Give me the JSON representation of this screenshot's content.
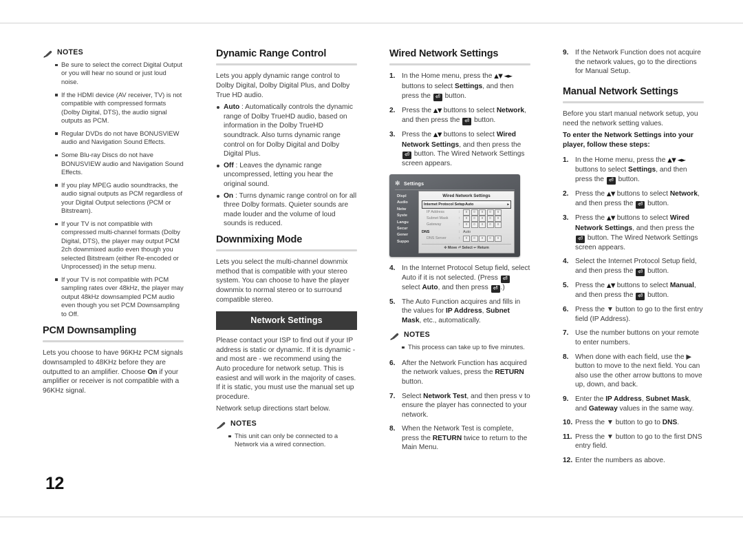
{
  "page": {
    "number": "12"
  },
  "icons": {
    "pencil": "pencil-icon",
    "gear": "gear-icon",
    "enter_key": "enter-key-icon",
    "return_key": "return-key-icon"
  },
  "labels": {
    "notes": "NOTES"
  },
  "col1": {
    "notes_title": "NOTES",
    "notes": [
      "Be sure to select the correct Digital Output or you will hear no sound or just loud noise.",
      "If the HDMI device (AV receiver, TV) is not compatible with compressed formats (Dolby Digital, DTS), the audio signal outputs as PCM.",
      "Regular DVDs do not have BONUSVIEW audio and Navigation Sound Effects.",
      "Some Blu-ray Discs do not have BONUSVIEW audio and Navigation Sound Effects.",
      "If you play MPEG audio soundtracks, the audio signal outputs as PCM regardless of your Digital Output selections (PCM or Bitstream).",
      "If your TV is not compatible with compressed multi-channel formats (Dolby Digital, DTS), the player may output PCM 2ch downmixed audio even though you selected Bitstream (either Re-encoded or Unprocessed) in the setup menu.",
      "If your TV is not compatible with PCM sampling rates over 48kHz, the player may output 48kHz downsampled PCM audio even though you set PCM Downsampling to Off."
    ],
    "pcm_heading": "PCM Downsampling",
    "pcm_body_1": "Lets you choose to have 96KHz PCM signals downsampled to 48KHz before they are outputted to an amplifier. Choose ",
    "pcm_body_bold": "On",
    "pcm_body_2": " if your amplifier or receiver is not compatible with a 96KHz signal."
  },
  "col2": {
    "drc_heading": "Dynamic Range Control",
    "drc_intro": "Lets you apply dynamic range control to Dolby Digital, Dolby Digital Plus, and Dolby True HD audio.",
    "drc_options": [
      {
        "name": "Auto",
        "text": " : Automatically controls the dynamic range of Dolby TrueHD audio, based on information in the Dolby TrueHD soundtrack.\nAlso turns dynamic range control on for Dolby Digital and Dolby Digital Plus."
      },
      {
        "name": "Off",
        "text": " : Leaves the dynamic range uncompressed, letting you hear the original sound."
      },
      {
        "name": "On",
        "text": " : Turns dynamic range control on for all three Dolby formats. Quieter sounds are made louder and the volume of loud sounds is reduced."
      }
    ],
    "downmix_heading": "Downmixing Mode",
    "downmix_body": "Lets you select the multi-channel downmix method that is compatible with your stereo system. You can choose to have the player downmix to normal stereo or to surround compatible stereo.",
    "banner": "Network Settings",
    "network_body": "Please contact your ISP to find out if your IP address is static or dynamic. If it is dynamic - and most are - we recommend using the Auto procedure for network setup. This is easiest and will work in the majority of cases. If it is static, you must use the manual set up procedure.",
    "network_body_2": "Network setup directions start below.",
    "notes_title": "NOTES",
    "notes": [
      "This unit can only be connected to a Network via a wired connection."
    ]
  },
  "col3": {
    "heading": "Wired Network Settings",
    "steps": [
      {
        "num": "1.",
        "parts": [
          "In the Home menu, press the ",
          "ARROWS",
          " buttons to select ",
          "B:Settings",
          ", and then press the ",
          "KEY",
          " button."
        ]
      },
      {
        "num": "2.",
        "parts": [
          "Press the ",
          "UPDOWN",
          " buttons to select ",
          "B:Network",
          ", and then press the ",
          "KEY",
          " button."
        ]
      },
      {
        "num": "3.",
        "parts": [
          "Press the ",
          "UPDOWN",
          " buttons to select ",
          "B:Wired Network Settings",
          ", and then press the ",
          "KEY",
          " button. The Wired Network Settings screen appears."
        ]
      }
    ],
    "steps_after": [
      {
        "num": "4.",
        "text_a": "In the Internet Protocol Setup field, select Auto if it is not selected. (Press ",
        "text_b": " select ",
        "bold": "Auto",
        "text_c": ", and then press ",
        "text_d": ".)"
      },
      {
        "num": "5.",
        "text": "The Auto Function acquires and fills in the values for IP Address, Subnet Mask, etc., automatically."
      }
    ],
    "notes_title": "NOTES",
    "notes": [
      "This process can take up to five minutes."
    ],
    "steps_tail": [
      {
        "num": "6.",
        "text": "After the Network Function has acquired the network values, press the RETURN button."
      },
      {
        "num": "7.",
        "text": "Select Network Test, and then press v to ensure the player has connected to your network."
      },
      {
        "num": "8.",
        "text": "When the Network Test is complete, press the RETURN twice to return to the Main Menu."
      }
    ],
    "figure": {
      "window_title": "Settings",
      "panel_title": "Wired Network Settings",
      "sidebar": [
        "Displ",
        "Audio",
        "Netw",
        "Syste",
        "Langu",
        "Secur",
        "Gener",
        "Suppo"
      ],
      "rows": [
        {
          "label": "Internet Protocol Setup",
          "value": "Auto",
          "highlight": true,
          "caret": "▸"
        },
        {
          "label": "IP Address",
          "boxes": [
            "0",
            "0",
            "0",
            "0",
            "0"
          ]
        },
        {
          "label": "Subnet Mask",
          "boxes": [
            "0",
            "0",
            "0",
            "0",
            "0"
          ]
        },
        {
          "label": "Gateway",
          "boxes": [
            "0",
            "0",
            "0",
            "0",
            "0"
          ]
        },
        {
          "label": "DNS",
          "value": "Auto",
          "section": true
        },
        {
          "label": "DNS Server",
          "boxes": [
            "0",
            "0",
            "0",
            "0",
            "0"
          ]
        }
      ],
      "footer": "Move  Select  Return",
      "footer_move": "Move",
      "footer_select": "Select",
      "footer_return": "Return"
    }
  },
  "col4": {
    "step9": {
      "num": "9.",
      "text": "If the Network Function does not acquire the network values, go to the directions for Manual Setup."
    },
    "heading": "Manual Network Settings",
    "intro": "Before you start manual network setup, you need the network setting values.",
    "intro_bold": "To enter the Network Settings into your player, follow these steps:",
    "steps": [
      {
        "num": "1.",
        "kind": "arrows",
        "a": "In the Home menu, press the ",
        "b": " buttons to select ",
        "bold": "Settings",
        "c": ", and then press the ",
        "d": " button."
      },
      {
        "num": "2.",
        "kind": "updown",
        "a": "Press the ",
        "b": " buttons to select ",
        "bold": "Network",
        "c": ", and then press the ",
        "d": " button."
      },
      {
        "num": "3.",
        "kind": "updown",
        "a": "Press the ",
        "b": " buttons to select ",
        "bold": "Wired Network Settings",
        "c": ", and then press the ",
        "d": " button. The Wired Network Settings screen appears."
      },
      {
        "num": "4.",
        "kind": "plain",
        "a": "Select the Internet Protocol Setup field, and then press the ",
        "d": " button."
      },
      {
        "num": "5.",
        "kind": "updown",
        "a": "Press the ",
        "b": " buttons to select ",
        "bold": "Manual",
        "c": ", and then press the ",
        "d": " button."
      }
    ],
    "steps_tail": [
      {
        "num": "6.",
        "text": "Press the ▼ button to go to the first entry field (IP Address)."
      },
      {
        "num": "7.",
        "text": "Use the number buttons on your remote to enter numbers."
      },
      {
        "num": "8.",
        "text": "When done with each field, use the ▶ button to move to the next field. You can also use the other arrow buttons to move up, down, and back."
      },
      {
        "num": "9.",
        "text": "Enter the IP Address, Subnet Mask, and Gateway values in the same way."
      },
      {
        "num": "10.",
        "text": "Press the ▼ button to go to DNS."
      },
      {
        "num": "11.",
        "text": "Press the ▼ button to go to the first DNS entry field."
      },
      {
        "num": "12.",
        "text": "Enter the numbers as above."
      }
    ]
  },
  "colors": {
    "banner_bg": "#3a3a3a",
    "text": "#3b3b3b",
    "heading": "#1d1d1d",
    "rule": "#d6d6d6"
  }
}
